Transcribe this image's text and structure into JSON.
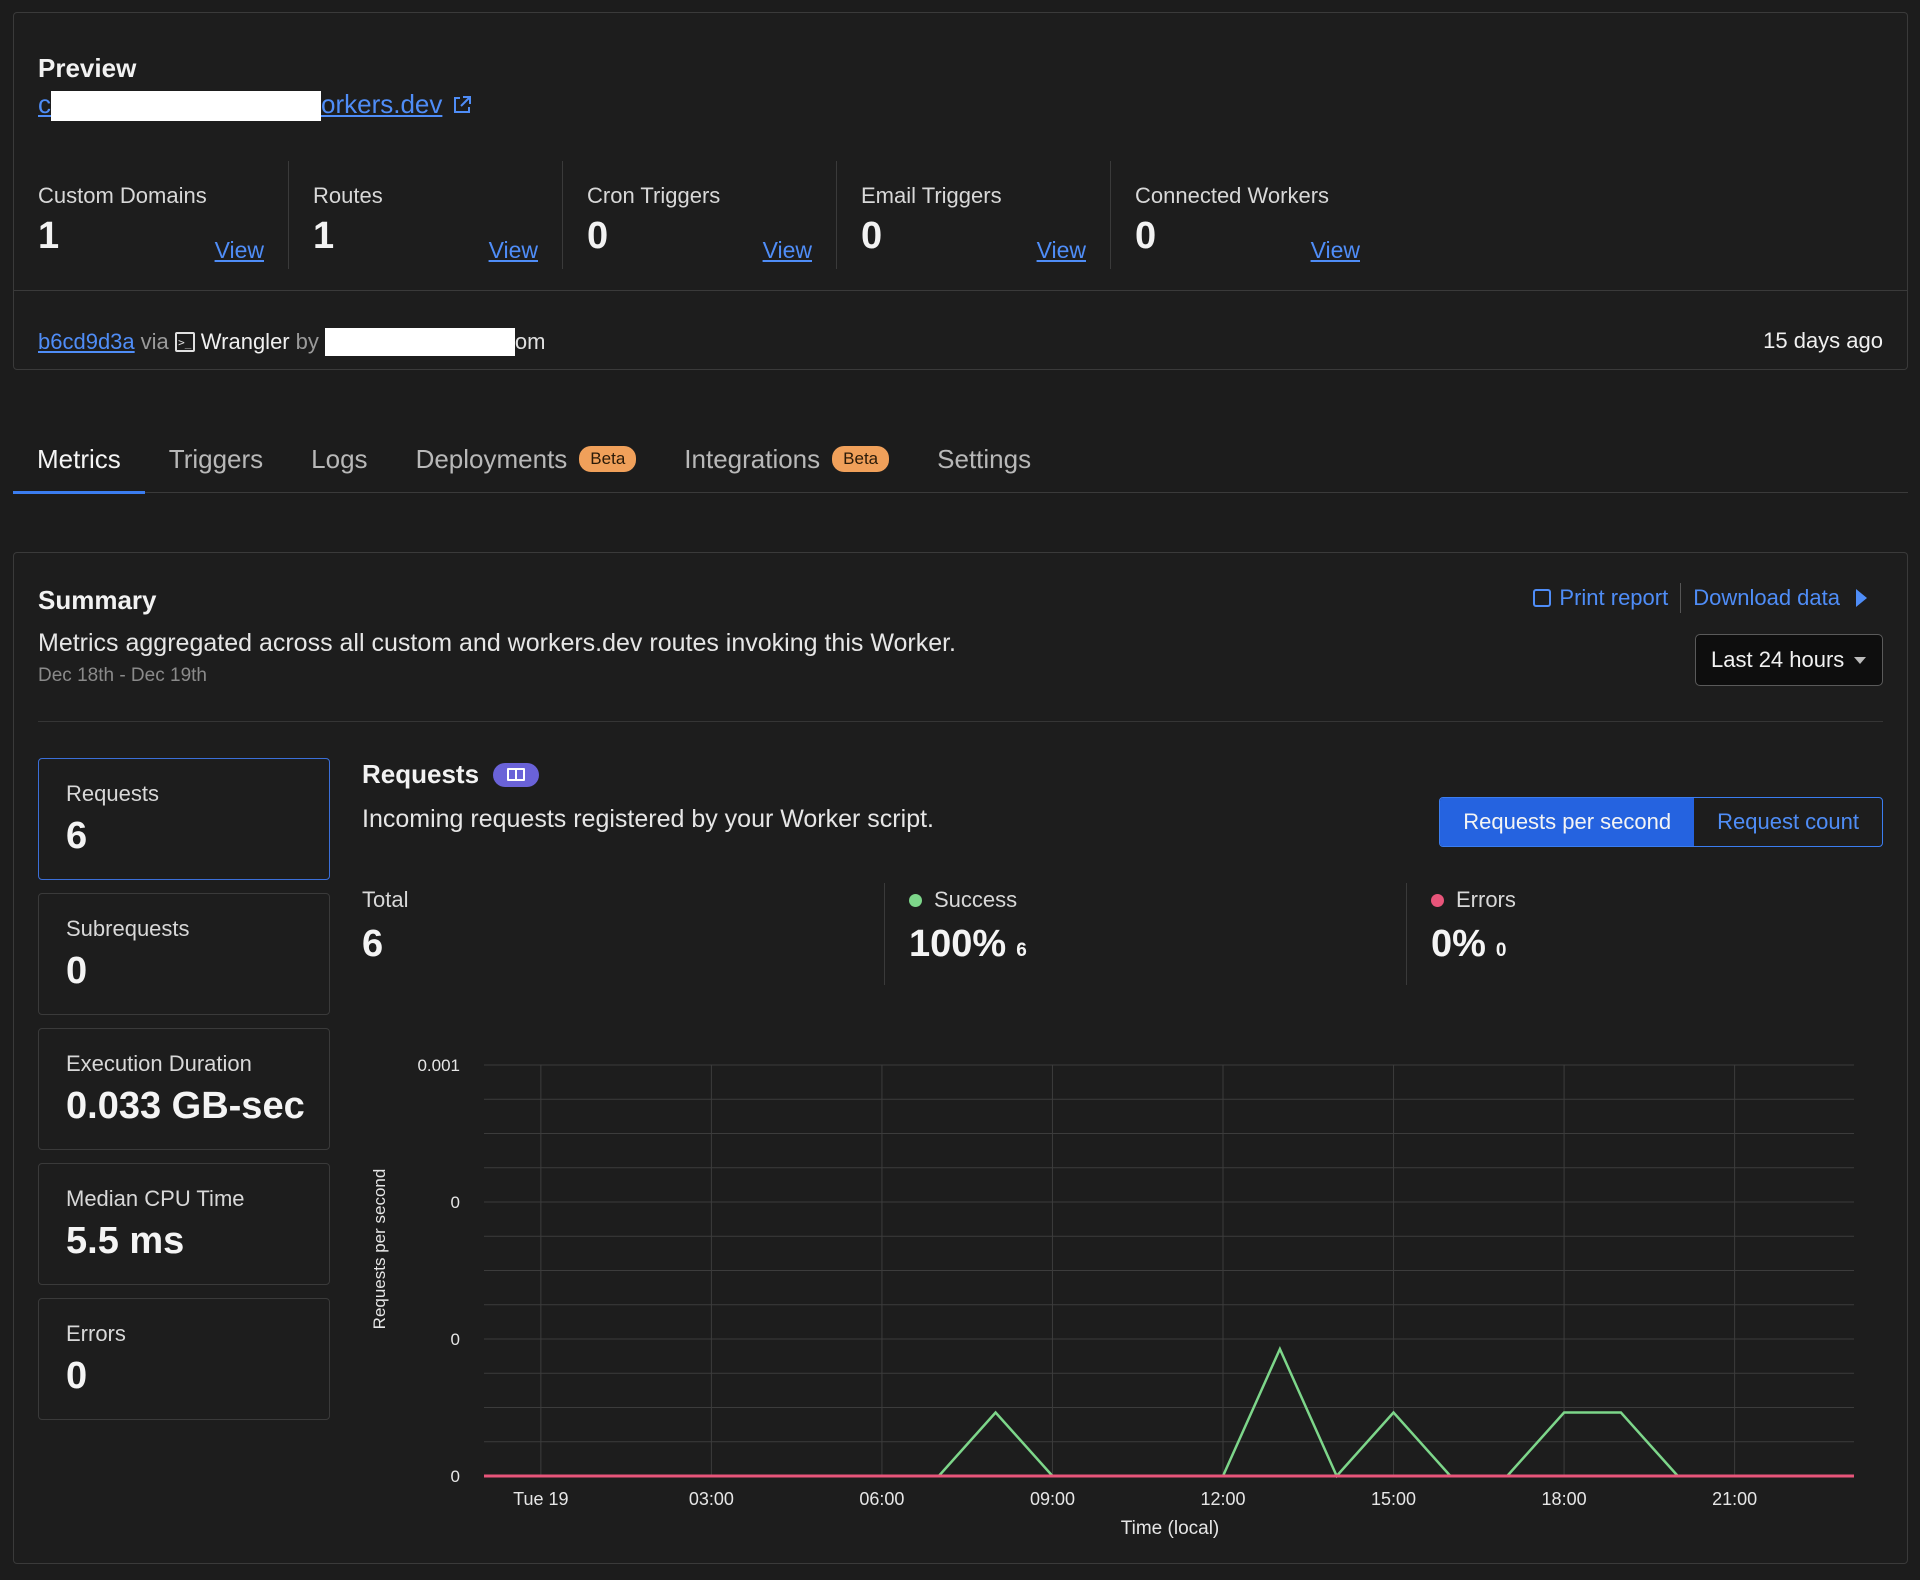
{
  "preview": {
    "label": "Preview",
    "url_prefix": "c",
    "url_suffix": "orkers.dev"
  },
  "stats": [
    {
      "label": "Custom Domains",
      "value": "1",
      "link": "View"
    },
    {
      "label": "Routes",
      "value": "1",
      "link": "View"
    },
    {
      "label": "Cron Triggers",
      "value": "0",
      "link": "View"
    },
    {
      "label": "Email Triggers",
      "value": "0",
      "link": "View"
    },
    {
      "label": "Connected Workers",
      "value": "0",
      "link": "View"
    }
  ],
  "deployment": {
    "commit": "b6cd9d3a",
    "via": "via",
    "tool": "Wrangler",
    "by": "by",
    "author_tail": "om",
    "age": "15 days ago"
  },
  "tabs": [
    {
      "label": "Metrics",
      "active": true
    },
    {
      "label": "Triggers"
    },
    {
      "label": "Logs"
    },
    {
      "label": "Deployments",
      "badge": "Beta"
    },
    {
      "label": "Integrations",
      "badge": "Beta"
    },
    {
      "label": "Settings"
    }
  ],
  "summary": {
    "title": "Summary",
    "description": "Metrics aggregated across all custom and workers.dev routes invoking this Worker.",
    "date_range": "Dec 18th - Dec 19th",
    "print_label": "Print report",
    "download_label": "Download data",
    "range_value": "Last 24 hours"
  },
  "metric_cards": [
    {
      "label": "Requests",
      "value": "6"
    },
    {
      "label": "Subrequests",
      "value": "0"
    },
    {
      "label": "Execution Duration",
      "value": "0.033 GB-sec"
    },
    {
      "label": "Median CPU Time",
      "value": "5.5 ms"
    },
    {
      "label": "Errors",
      "value": "0"
    }
  ],
  "requests": {
    "title": "Requests",
    "description": "Incoming requests registered by your Worker script.",
    "toggle_on": "Requests per second",
    "toggle_off": "Request count",
    "total_label": "Total",
    "total_value": "6",
    "success_label": "Success",
    "success_value": "100%",
    "success_count": "6",
    "errors_label": "Errors",
    "errors_value": "0%",
    "errors_count": "0"
  },
  "colors": {
    "success": "#7dd68a",
    "errors": "#e8557a",
    "accent": "#3b7df0",
    "badge": "#f0a05a"
  },
  "chart_data": {
    "type": "line",
    "ylabel": "Requests per second",
    "xlabel": "Time (local)",
    "x_ticks": [
      "Tue 19",
      "03:00",
      "06:00",
      "09:00",
      "12:00",
      "15:00",
      "18:00",
      "21:00"
    ],
    "y_ticks": [
      "0",
      "0",
      "0",
      "0.001"
    ],
    "ylim": [
      0,
      0.0009
    ],
    "grid": true,
    "series": [
      {
        "name": "Success",
        "color": "#7dd68a",
        "x_hours": [
          -1,
          7,
          8,
          9,
          12,
          13,
          14,
          15,
          16,
          17,
          18,
          19,
          20,
          23.1
        ],
        "values": [
          0,
          0,
          0.000139,
          0,
          0,
          0.000278,
          0,
          0.000139,
          0,
          0,
          0.000139,
          0.000139,
          0,
          0
        ]
      },
      {
        "name": "Errors",
        "color": "#e8557a",
        "x_hours": [
          -1,
          23.1
        ],
        "values": [
          0,
          0
        ]
      }
    ]
  }
}
